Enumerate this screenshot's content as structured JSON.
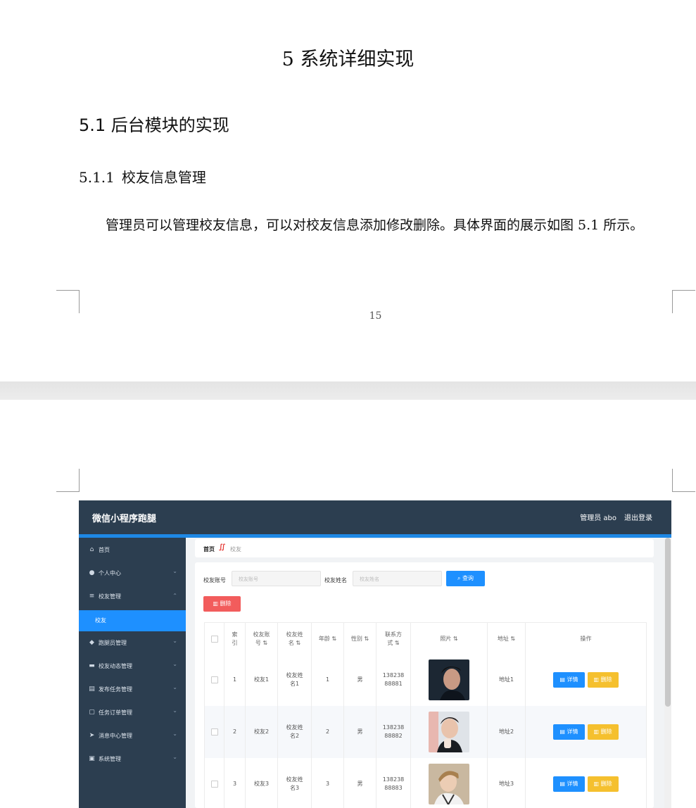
{
  "document": {
    "chapter_title": "5 系统详细实现",
    "section_title": "5.1 后台模块的实现",
    "subsection_num": "5.1.1",
    "subsection_title": "校友信息管理",
    "paragraph": "管理员可以管理校友信息，可以对校友信息添加修改删除。具体界面的展示如图 5.1 所示。",
    "page_number": "15"
  },
  "app": {
    "brand": "微信小程序跑腿",
    "user": "管理员 abo",
    "logout": "退出登录",
    "menu": [
      {
        "label": "首页",
        "icon": "home-icon",
        "glyph": "⌂"
      },
      {
        "label": "个人中心",
        "icon": "user-icon",
        "glyph": "●"
      },
      {
        "label": "校友管理",
        "icon": "list-icon",
        "glyph": "≡"
      },
      {
        "label": "校友",
        "icon": "",
        "glyph": ""
      },
      {
        "label": "跑腿员管理",
        "icon": "runner-icon",
        "glyph": "◆"
      },
      {
        "label": "校友动态管理",
        "icon": "news-icon",
        "glyph": "▬"
      },
      {
        "label": "发布任务管理",
        "icon": "task-icon",
        "glyph": "▤"
      },
      {
        "label": "任务订单管理",
        "icon": "order-icon",
        "glyph": "▢"
      },
      {
        "label": "消息中心管理",
        "icon": "send-icon",
        "glyph": "➤"
      },
      {
        "label": "系统管理",
        "icon": "settings-icon",
        "glyph": "▣"
      }
    ],
    "breadcrumb": {
      "home": "首页",
      "separator": "∬",
      "current": "校友"
    },
    "search": {
      "account_label": "校友账号",
      "account_placeholder": "校友账号",
      "name_label": "校友姓名",
      "name_placeholder": "校友姓名",
      "query_button": "查询"
    },
    "delete_button": "删除",
    "table": {
      "headers": [
        "索引",
        "校友账号",
        "校友姓名",
        "年龄",
        "性别",
        "联系方式",
        "照片",
        "地址",
        "操作"
      ],
      "rows": [
        {
          "index": "1",
          "account": "校友1",
          "name": "校友姓名1",
          "age": "1",
          "gender": "男",
          "phone": "13823888881",
          "address": "地址1"
        },
        {
          "index": "2",
          "account": "校友2",
          "name": "校友姓名2",
          "age": "2",
          "gender": "男",
          "phone": "13823888882",
          "address": "地址2"
        },
        {
          "index": "3",
          "account": "校友3",
          "name": "校友姓名3",
          "age": "3",
          "gender": "男",
          "phone": "13823888883",
          "address": "地址3"
        }
      ],
      "detail_button": "详情",
      "row_delete_button": "删除"
    },
    "colors": {
      "header": "#2c3e50",
      "accent": "#1e90ff",
      "danger": "#f25c5c",
      "warning": "#f5c02e"
    }
  }
}
